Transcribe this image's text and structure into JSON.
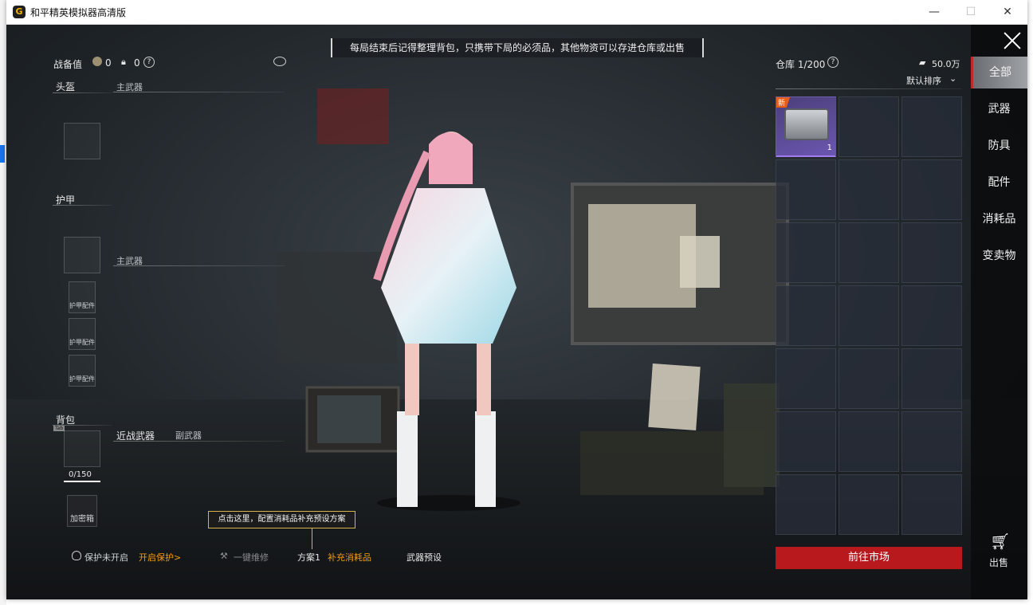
{
  "window": {
    "title": "和平精英模拟器高清版",
    "minimize_glyph": "—",
    "maximize_glyph": "☐",
    "close_glyph": "✕"
  },
  "banner": {
    "text": "每局结束后记得整理背包，只携带下局的必须品，其他物资可以存进仓库或出售"
  },
  "loadout": {
    "title": "战备值",
    "value": "0",
    "lock_value": "0",
    "help": "?",
    "sections": {
      "helmet": "头盔",
      "primary_weapon_1": "主武器",
      "armor": "护甲",
      "primary_weapon_2": "主武器",
      "backpack": "背包",
      "melee": "近战武器",
      "secondary": "副武器"
    },
    "armor_attachments": [
      "护甲配件",
      "护甲配件",
      "护甲配件"
    ],
    "backpack_capacity": "0/150",
    "backpack_tab": "Tab",
    "safe_box": "加密箱"
  },
  "bottom": {
    "protect_status": "保护未开启",
    "protect_action": "开启保护>",
    "repair": "一键维修",
    "plan": "方案1",
    "supply": "补充消耗品",
    "weapon_preset": "武器预设",
    "tooltip": "点击这里，配置消耗品补充预设方案"
  },
  "warehouse": {
    "title": "仓库 1/200",
    "help": "?",
    "money": "50.0万",
    "sort": "默认排序",
    "new_badge": "新",
    "item_count": "1",
    "market_button": "前往市场"
  },
  "nav": {
    "items": [
      "全部",
      "武器",
      "防具",
      "配件",
      "消耗品",
      "变卖物"
    ],
    "active": "全部",
    "sell": "出售"
  },
  "colors": {
    "accent_red": "#b8191c",
    "highlight_orange": "#f39c12",
    "tooltip_border": "#d8b24a"
  }
}
